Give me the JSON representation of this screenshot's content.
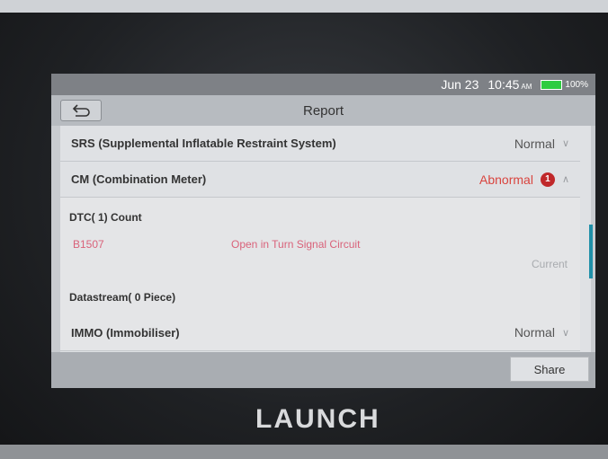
{
  "status_bar": {
    "date": "Jun 23",
    "time": "10:45",
    "ampm": "AM",
    "battery": "100%"
  },
  "header": {
    "title": "Report"
  },
  "systems": [
    {
      "name": "SRS (Supplemental Inflatable Restraint System)",
      "status": "Normal"
    },
    {
      "name": "CM (Combination Meter)",
      "status": "Abnormal",
      "badge": "1"
    },
    {
      "name": "IMMO (Immobiliser)",
      "status": "Normal"
    }
  ],
  "cm_details": {
    "dtc_header": "DTC( 1) Count",
    "dtcs": [
      {
        "code": "B1507",
        "description": "Open in Turn Signal Circuit",
        "state": "Current"
      }
    ],
    "datastream_header": "Datastream( 0 Piece)"
  },
  "footer": {
    "share_label": "Share"
  },
  "device": {
    "brand": "LAUNCH"
  },
  "colors": {
    "abnormal": "#d9453f",
    "dtc": "#d9627a",
    "accent": "#1f8fa8",
    "battery": "#2ecc40"
  }
}
